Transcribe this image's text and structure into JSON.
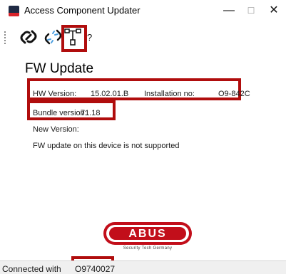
{
  "window": {
    "title": "Access Component Updater",
    "icon": "app-icon",
    "minimize_glyph": "—",
    "maximize_glyph": "☐",
    "close_glyph": "✕"
  },
  "toolbar": {
    "items": [
      {
        "name": "connect",
        "icon": "link-icon"
      },
      {
        "name": "disconnect",
        "icon": "broken-link-icon"
      },
      {
        "name": "device-tree",
        "icon": "tree-icon"
      },
      {
        "name": "help",
        "label": "?"
      }
    ]
  },
  "fw_update": {
    "heading": "FW Update",
    "hw_version_label": "HW Version:",
    "hw_version_value": "15.02.01.B",
    "installation_no_label": "Installation no:",
    "installation_no_value": "O9-842C",
    "bundle_version_label": "Bundle version:",
    "bundle_version_value": "71.18",
    "new_version_label": "New Version:",
    "message": "FW update on this device is not supported"
  },
  "logo": {
    "brand": "ABUS",
    "tagline": "Security Tech Germany"
  },
  "status": {
    "label": "Connected with",
    "value": "O9740027"
  },
  "colors": {
    "highlight": "#b00d0d",
    "brand_red": "#c20e1a"
  }
}
